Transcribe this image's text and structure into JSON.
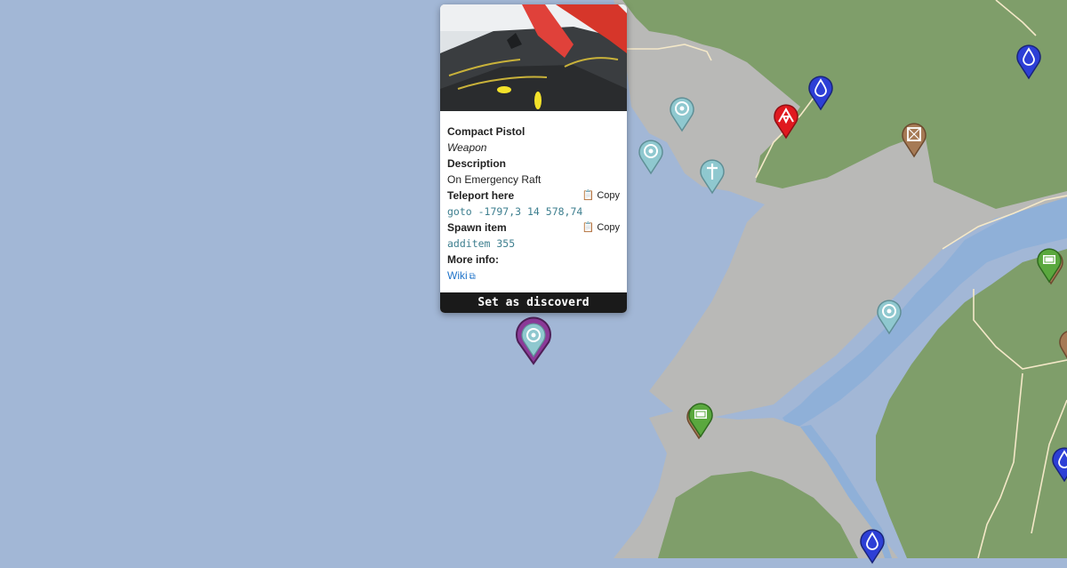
{
  "popup": {
    "title": "Compact Pistol",
    "category": "Weapon",
    "description_label": "Description",
    "description": "On Emergency Raft",
    "teleport_label": "Teleport here",
    "teleport_command": "goto -1797,3 14 578,74",
    "spawn_label": "Spawn item",
    "spawn_command": "additem 355",
    "copy_label": "Copy",
    "more_info_label": "More info:",
    "wiki_label": "Wiki",
    "discover_label": "Set as discoverd"
  },
  "map": {
    "colors": {
      "water": "#a2b7d6",
      "sand": "#b9b9b7",
      "forest": "#7f9e6a",
      "river": "#8fb0d8",
      "path": "#f4e8c8"
    },
    "markers": [
      {
        "name": "location-marker",
        "icon": "target-icon",
        "color": "#8fc8cf"
      },
      {
        "name": "location-marker",
        "icon": "target-icon",
        "color": "#8fc8cf"
      },
      {
        "name": "location-marker",
        "icon": "target-icon",
        "color": "#8fc8cf"
      },
      {
        "name": "grave-marker",
        "icon": "cross-icon",
        "color": "#8fc8cf"
      },
      {
        "name": "camp-marker",
        "icon": "tent-icon",
        "color": "#e0191f"
      },
      {
        "name": "water-marker",
        "icon": "water-drop-icon",
        "color": "#2d3fd6"
      },
      {
        "name": "water-marker",
        "icon": "water-drop-icon",
        "color": "#2d3fd6"
      },
      {
        "name": "water-marker",
        "icon": "water-drop-icon",
        "color": "#2d3fd6"
      },
      {
        "name": "water-marker",
        "icon": "water-drop-icon",
        "color": "#2d3fd6"
      },
      {
        "name": "crate-marker",
        "icon": "crate-icon",
        "color": "#a67a55"
      },
      {
        "name": "item-marker",
        "icon": "ticket-icon",
        "color": "#5aa83e"
      },
      {
        "name": "item-marker",
        "icon": "ticket-icon",
        "color": "#5aa83e"
      },
      {
        "name": "selected-marker",
        "icon": "target-icon",
        "color": "#8b3a98"
      }
    ]
  }
}
